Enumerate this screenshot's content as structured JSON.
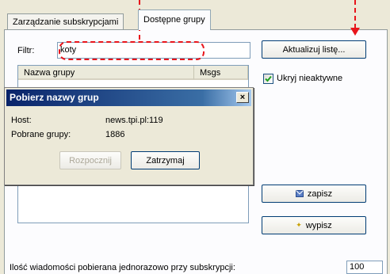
{
  "tabs": [
    {
      "label": "Zarządzanie subskrypcjami",
      "active": false
    },
    {
      "label": "Dostępne grupy",
      "active": true
    }
  ],
  "filter": {
    "label": "Filtr:",
    "value": "koty"
  },
  "buttons": {
    "refresh": "Aktualizuj listę...",
    "subscribe": "zapisz",
    "unsubscribe": "wypisz"
  },
  "list": {
    "columns": [
      "Nazwa grupy",
      "Msgs"
    ]
  },
  "hide_inactive": {
    "label": "Ukryj nieaktywne",
    "checked": true
  },
  "dialog": {
    "title": "Pobierz nazwy grup",
    "host_label": "Host:",
    "host_value": "news.tpi.pl:119",
    "groups_label": "Pobrane grupy:",
    "groups_value": "1886",
    "start_button": "Rozpocznij",
    "stop_button": "Zatrzymaj",
    "close_symbol": "×"
  },
  "footer": {
    "label": "Ilość wiadomości pobierana jednorazowo przy subskrypcji:",
    "value": "100"
  },
  "colors": {
    "annotation": "#e8151b",
    "accent": "#0a246a"
  }
}
